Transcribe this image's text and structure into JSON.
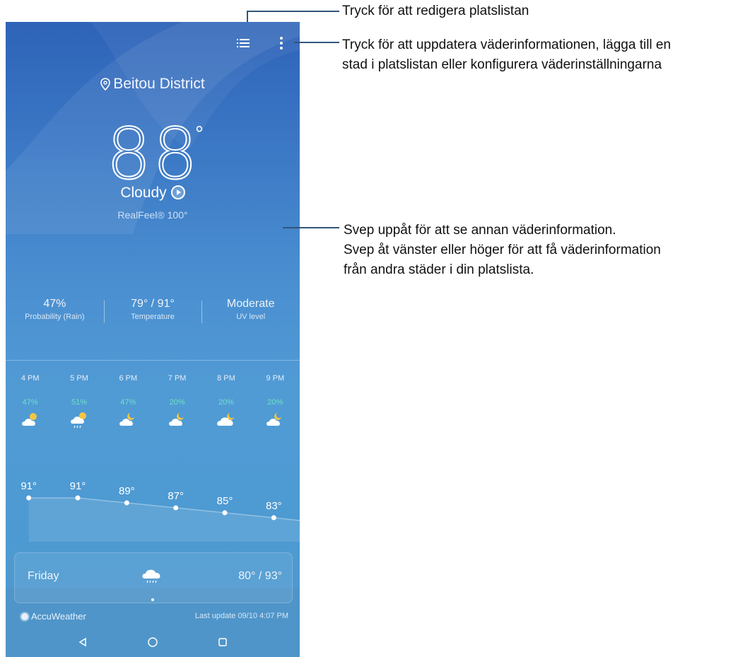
{
  "location": "Beitou District",
  "current": {
    "temperature": "88",
    "degree_symbol": "°",
    "condition": "Cloudy",
    "realfeel": "RealFeel® 100°"
  },
  "stats": [
    {
      "value": "47%",
      "label": "Probability (Rain)"
    },
    {
      "value": "79° / 91°",
      "label": "Temperature"
    },
    {
      "value": "Moderate",
      "label": "UV level"
    }
  ],
  "hourly": [
    {
      "time": "4 PM",
      "precip": "47%",
      "icon": "partly-cloudy-sun-icon",
      "temp_label": "91°",
      "temp": 91
    },
    {
      "time": "5 PM",
      "precip": "51%",
      "icon": "cloud-sun-rain-icon",
      "temp_label": "91°",
      "temp": 91
    },
    {
      "time": "6 PM",
      "precip": "47%",
      "icon": "partly-cloudy-night-icon",
      "temp_label": "89°",
      "temp": 89
    },
    {
      "time": "7 PM",
      "precip": "20%",
      "icon": "partly-cloudy-night-icon",
      "temp_label": "87°",
      "temp": 87
    },
    {
      "time": "8 PM",
      "precip": "20%",
      "icon": "cloudy-night-icon",
      "temp_label": "85°",
      "temp": 85
    },
    {
      "time": "9 PM",
      "precip": "20%",
      "icon": "partly-cloudy-night-icon",
      "temp_label": "83°",
      "temp": 83
    }
  ],
  "daily_card": {
    "day": "Friday",
    "icon": "rain-cloud-icon",
    "range": "80° / 93°"
  },
  "footer": {
    "brand": "AccuWeather",
    "last_update": "Last update 09/10 4:07 PM"
  },
  "icons": {
    "list": "list-icon",
    "menu": "more-vert-icon",
    "back": "back-icon",
    "home": "home-icon",
    "recent": "recent-apps-icon"
  },
  "callouts": {
    "list_note": "Tryck för att redigera platslistan",
    "menu_note_line1": "Tryck för att uppdatera väderinformationen, lägga till en",
    "menu_note_line2": "stad i platslistan eller konfigurera väderinställningarna",
    "swipe_note_line1": "Svep uppåt för att se annan väderinformation.",
    "swipe_note_line2": "Svep åt vänster eller höger för att få väderinformation",
    "swipe_note_line3": "från andra städer i din platslista."
  },
  "colors": {
    "precip_text": "#6fe0c6",
    "callout_line": "#33557a"
  }
}
